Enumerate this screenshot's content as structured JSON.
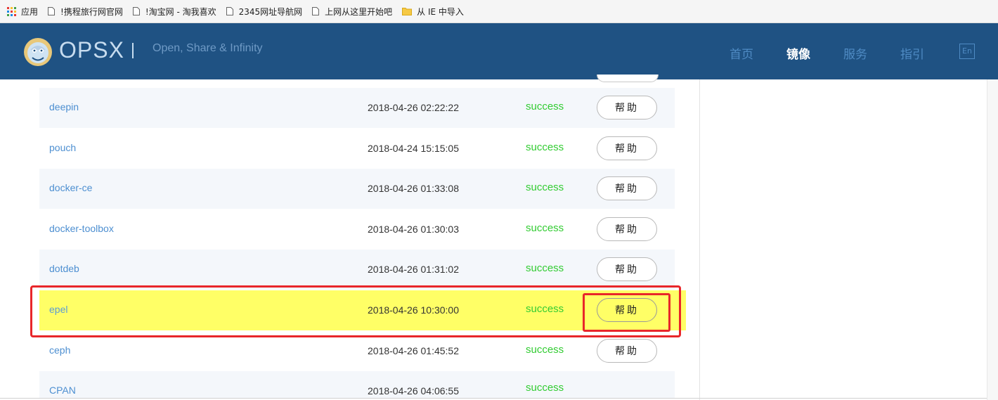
{
  "bookmarks": [
    {
      "label": "应用",
      "icon": "apps-grid-icon"
    },
    {
      "label": "!携程旅行网官网",
      "icon": "page-icon"
    },
    {
      "label": "!淘宝网 - 淘我喜欢",
      "icon": "page-icon"
    },
    {
      "label": "2345网址导航网",
      "icon": "page-icon"
    },
    {
      "label": "上网从这里开始吧",
      "icon": "page-icon"
    },
    {
      "label": "从 IE 中导入",
      "icon": "folder-icon"
    }
  ],
  "header": {
    "brand": "OPSX",
    "tagline": "Open, Share & Infinity",
    "nav": [
      {
        "label": "首页",
        "active": false
      },
      {
        "label": "镜像",
        "active": true
      },
      {
        "label": "服务",
        "active": false
      },
      {
        "label": "指引",
        "active": false
      }
    ],
    "lang_label": "En",
    "bg_color": "#1f5283"
  },
  "mirrors": {
    "help_label": "帮助",
    "rows": [
      {
        "name": "deepin",
        "date": "2018-04-26 02:22:22",
        "status": "success",
        "has_help": true
      },
      {
        "name": "pouch",
        "date": "2018-04-24 15:15:05",
        "status": "success",
        "has_help": true
      },
      {
        "name": "docker-ce",
        "date": "2018-04-26 01:33:08",
        "status": "success",
        "has_help": true
      },
      {
        "name": "docker-toolbox",
        "date": "2018-04-26 01:30:03",
        "status": "success",
        "has_help": true
      },
      {
        "name": "dotdeb",
        "date": "2018-04-26 01:31:02",
        "status": "success",
        "has_help": true
      },
      {
        "name": "epel",
        "date": "2018-04-26 10:30:00",
        "status": "success",
        "has_help": true,
        "highlighted": true
      },
      {
        "name": "ceph",
        "date": "2018-04-26 01:45:52",
        "status": "success",
        "has_help": true
      },
      {
        "name": "CPAN",
        "date": "2018-04-26 04:06:55",
        "status": "success",
        "has_help": false
      }
    ]
  },
  "colors": {
    "status_success": "#33cc33",
    "link": "#4d8fd1",
    "highlight": "#ffff66",
    "annotation": "#e8262a"
  }
}
